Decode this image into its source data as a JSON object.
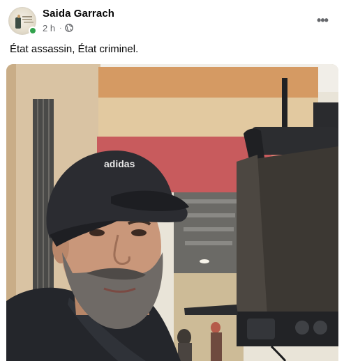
{
  "post": {
    "author": "Saida Garrach",
    "time": "2 h",
    "separator": "·",
    "privacy_icon": "globe-icon",
    "more_icon": "more-options-icon",
    "more_label": "•••",
    "text": "État assassin, État criminel.",
    "photo": {
      "description_icon": "photo",
      "cap_brand": "adidas"
    }
  },
  "colors": {
    "online": "#31a24c",
    "secondary_text": "#65676b",
    "primary_text": "#050505"
  }
}
